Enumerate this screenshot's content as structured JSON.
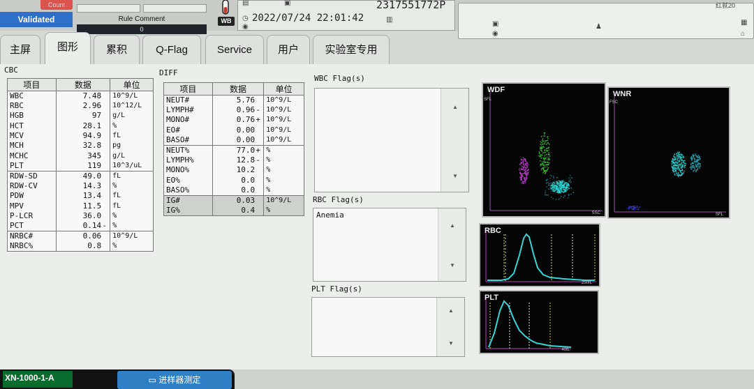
{
  "header": {
    "count_label": "Count",
    "validated_label": "Validated",
    "rule_comment_label": "Rule Comment",
    "rule_comment_value": "0",
    "wb_label": "WB",
    "datetime": "2022/07/24 22:01:42",
    "sample_id": "2317551772P",
    "right_top_text": "红就20"
  },
  "tabs": [
    {
      "label": "主屏",
      "active": false
    },
    {
      "label": "图形",
      "active": true
    },
    {
      "label": "累积",
      "active": false
    },
    {
      "label": "Q-Flag",
      "active": false
    },
    {
      "label": "Service",
      "active": false
    },
    {
      "label": "用户",
      "active": false
    },
    {
      "label": "实验室专用",
      "active": false
    }
  ],
  "cbc": {
    "title": "CBC",
    "headers": [
      "项目",
      "数据",
      "单位"
    ],
    "rows": [
      {
        "item": "WBC",
        "value": "7.48",
        "flag": "",
        "unit": "10^9/L"
      },
      {
        "item": "RBC",
        "value": "2.96",
        "flag": "",
        "unit": "10^12/L"
      },
      {
        "item": "HGB",
        "value": "97",
        "flag": "",
        "unit": "g/L"
      },
      {
        "item": "HCT",
        "value": "28.1",
        "flag": "",
        "unit": "%"
      },
      {
        "item": "MCV",
        "value": "94.9",
        "flag": "",
        "unit": "fL"
      },
      {
        "item": "MCH",
        "value": "32.8",
        "flag": "",
        "unit": "pg"
      },
      {
        "item": "MCHC",
        "value": "345",
        "flag": "",
        "unit": "g/L"
      },
      {
        "item": "PLT",
        "value": "119",
        "flag": "",
        "unit": "10^3/uL"
      },
      {
        "item": "RDW-SD",
        "value": "49.0",
        "flag": "",
        "unit": "fL"
      },
      {
        "item": "RDW-CV",
        "value": "14.3",
        "flag": "",
        "unit": "%"
      },
      {
        "item": "PDW",
        "value": "13.4",
        "flag": "",
        "unit": "fL"
      },
      {
        "item": "MPV",
        "value": "11.5",
        "flag": "",
        "unit": "fL"
      },
      {
        "item": "P-LCR",
        "value": "36.0",
        "flag": "",
        "unit": "%"
      },
      {
        "item": "PCT",
        "value": "0.14",
        "flag": "-",
        "unit": "%"
      },
      {
        "item": "NRBC#",
        "value": "0.06",
        "flag": "",
        "unit": "10^9/L"
      },
      {
        "item": "NRBC%",
        "value": "0.8",
        "flag": "",
        "unit": "%"
      }
    ]
  },
  "diff": {
    "title": "DIFF",
    "headers": [
      "项目",
      "数据",
      "单位"
    ],
    "rows": [
      {
        "item": "NEUT#",
        "value": "5.76",
        "flag": "",
        "unit": "10^9/L"
      },
      {
        "item": "LYMPH#",
        "value": "0.96",
        "flag": "-",
        "unit": "10^9/L"
      },
      {
        "item": "MONO#",
        "value": "0.76",
        "flag": "+",
        "unit": "10^9/L"
      },
      {
        "item": "EO#",
        "value": "0.00",
        "flag": "",
        "unit": "10^9/L"
      },
      {
        "item": "BASO#",
        "value": "0.00",
        "flag": "",
        "unit": "10^9/L"
      },
      {
        "item": "NEUT%",
        "value": "77.0",
        "flag": "+",
        "unit": "%"
      },
      {
        "item": "LYMPH%",
        "value": "12.8",
        "flag": "-",
        "unit": "%"
      },
      {
        "item": "MONO%",
        "value": "10.2",
        "flag": "",
        "unit": "%"
      },
      {
        "item": "EO%",
        "value": "0.0",
        "flag": "",
        "unit": "%"
      },
      {
        "item": "BASO%",
        "value": "0.0",
        "flag": "",
        "unit": "%"
      },
      {
        "item": "IG#",
        "value": "0.03",
        "flag": "",
        "unit": "10^9/L"
      },
      {
        "item": "IG%",
        "value": "0.4",
        "flag": "",
        "unit": "%"
      }
    ]
  },
  "flags": {
    "wbc_title": "WBC Flag(s)",
    "wbc_text": "",
    "rbc_title": "RBC Flag(s)",
    "rbc_text": "Anemia",
    "plt_title": "PLT Flag(s)",
    "plt_text": ""
  },
  "plots": {
    "wdf": {
      "title": "WDF",
      "y_label": "SFL",
      "x_label": "SSC"
    },
    "wnr": {
      "title": "WNR",
      "y_label": "FSC",
      "x_label": "SFL"
    },
    "rbc": {
      "title": "RBC",
      "x_label": "250fL"
    },
    "plt": {
      "title": "PLT",
      "x_label": "40fL"
    }
  },
  "colors": {
    "validated": "#2e6fc9",
    "count": "#d9534f",
    "plot_magenta": "#b040c0",
    "plot_cyan": "#2fd6d6",
    "plot_green": "#3fc23f"
  },
  "footer": {
    "model_name": "XN-1000-1-A",
    "sampler_button": "进样器测定"
  }
}
